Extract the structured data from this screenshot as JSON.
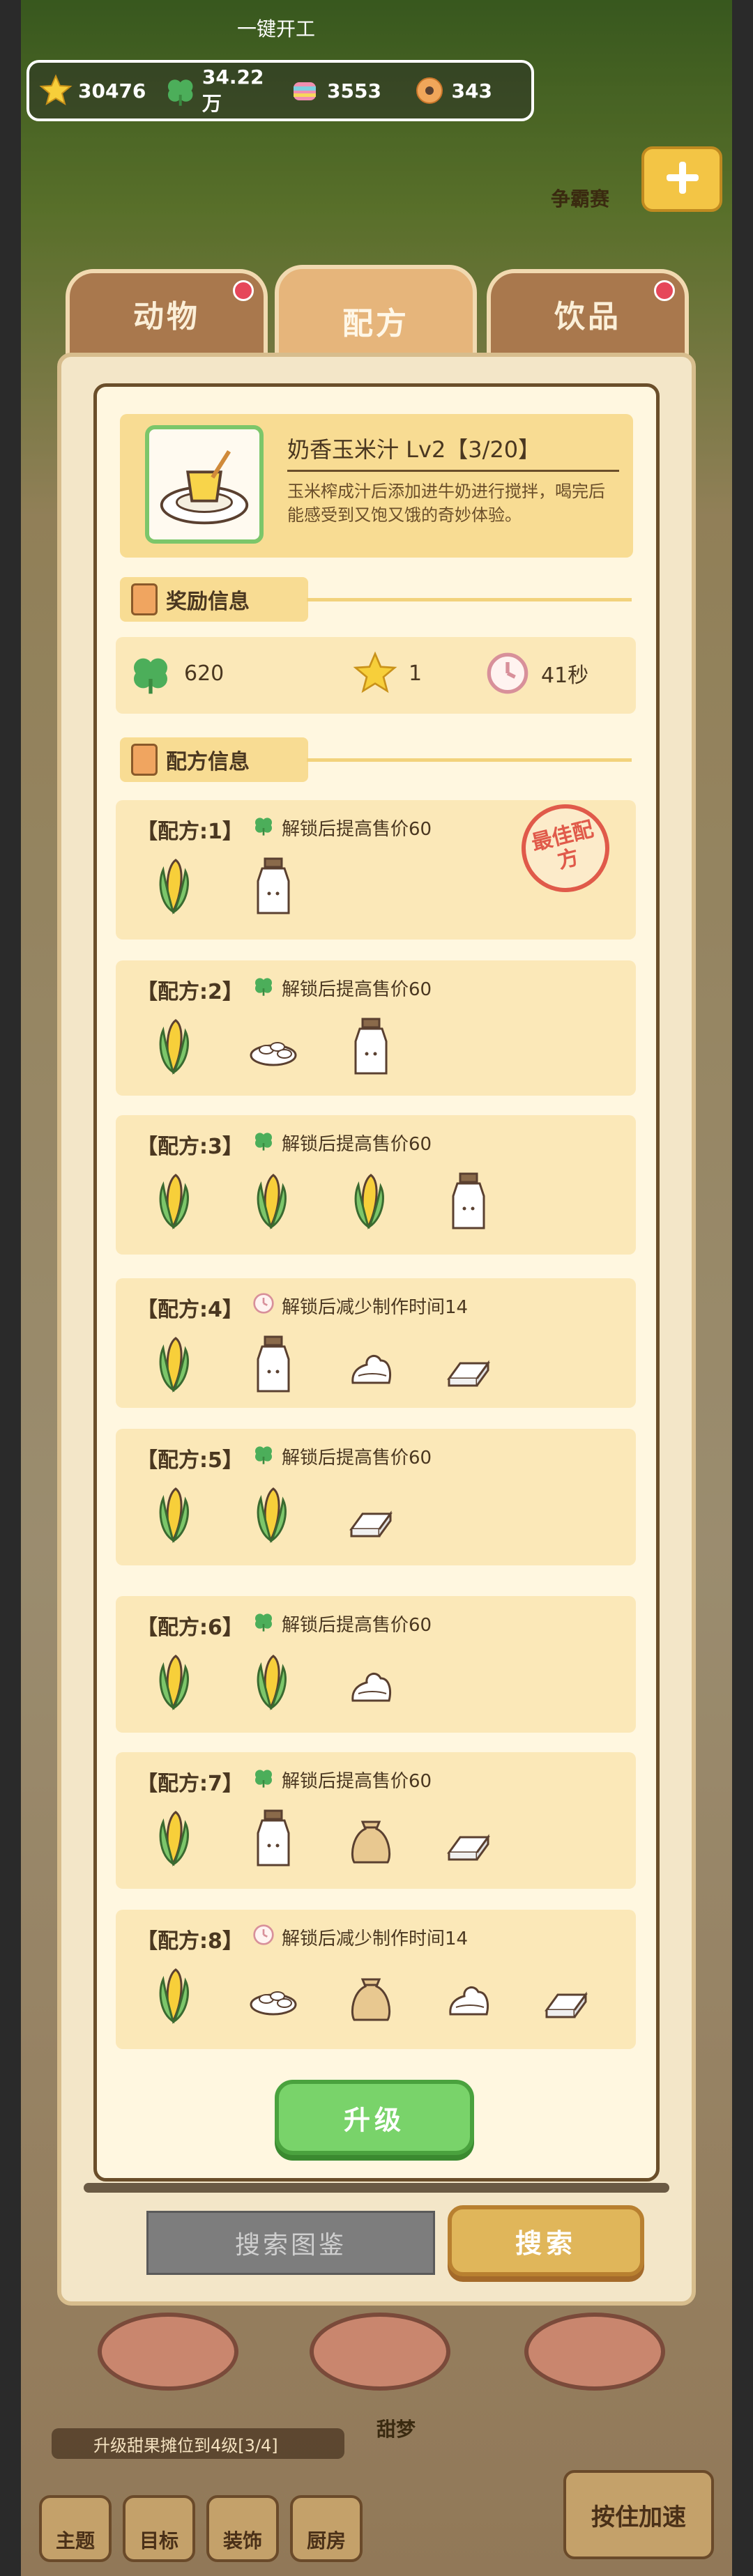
{
  "top": {
    "button_label": "一键开工",
    "rank_label": "争霸赛"
  },
  "resources": [
    {
      "icon": "star-icon",
      "value": "30476"
    },
    {
      "icon": "clover-icon",
      "value": "34.22万"
    },
    {
      "icon": "candy-icon",
      "value": "3553"
    },
    {
      "icon": "donut-icon",
      "value": "343"
    }
  ],
  "tabs": [
    {
      "label": "动物",
      "badge": true
    },
    {
      "label": "配方",
      "active": true
    },
    {
      "label": "饮品",
      "badge": true
    }
  ],
  "item": {
    "title": "奶香玉米汁 Lv2【3/20】",
    "description": "玉米榨成汁后添加进牛奶进行搅拌，喝完后能感受到又饱又饿的奇妙体验。"
  },
  "sections": {
    "reward": "奖励信息",
    "recipe": "配方信息"
  },
  "rewards": [
    {
      "icon": "clover-icon",
      "value": "620"
    },
    {
      "icon": "star-icon",
      "value": "1"
    },
    {
      "icon": "clock-icon",
      "value": "41秒"
    }
  ],
  "best_stamp": "最佳配方",
  "recipes": [
    {
      "title": "【配方:1】",
      "note_icon": "clover-icon",
      "note": "解锁后提高售价60",
      "ingredients": [
        "corn",
        "milk"
      ],
      "best": true
    },
    {
      "title": "【配方:2】",
      "note_icon": "clover-icon",
      "note": "解锁后提高售价60",
      "ingredients": [
        "corn",
        "rice",
        "milk"
      ]
    },
    {
      "title": "【配方:3】",
      "note_icon": "clover-icon",
      "note": "解锁后提高售价60",
      "ingredients": [
        "corn",
        "corn",
        "corn",
        "milk"
      ]
    },
    {
      "title": "【配方:4】",
      "note_icon": "clock-icon",
      "note": "解锁后减少制作时间14",
      "ingredients": [
        "corn",
        "milk",
        "cream",
        "butter"
      ]
    },
    {
      "title": "【配方:5】",
      "note_icon": "clover-icon",
      "note": "解锁后提高售价60",
      "ingredients": [
        "corn",
        "corn",
        "butter"
      ]
    },
    {
      "title": "【配方:6】",
      "note_icon": "clover-icon",
      "note": "解锁后提高售价60",
      "ingredients": [
        "corn",
        "corn",
        "cream"
      ]
    },
    {
      "title": "【配方:7】",
      "note_icon": "clover-icon",
      "note": "解锁后提高售价60",
      "ingredients": [
        "corn",
        "milk",
        "flour",
        "butter"
      ]
    },
    {
      "title": "【配方:8】",
      "note_icon": "clock-icon",
      "note": "解锁后减少制作时间14",
      "ingredients": [
        "corn",
        "rice",
        "flour",
        "cream",
        "butter"
      ]
    }
  ],
  "buttons": {
    "upgrade": "升级",
    "search_catalog": "搜索图鉴",
    "search": "搜索",
    "hold_speed": "按住加速"
  },
  "bottom": {
    "tip": "升级甜果摊位到4级[3/4]",
    "mid_label": "甜梦",
    "nav": [
      "主题",
      "目标",
      "装饰",
      "厨房"
    ]
  }
}
